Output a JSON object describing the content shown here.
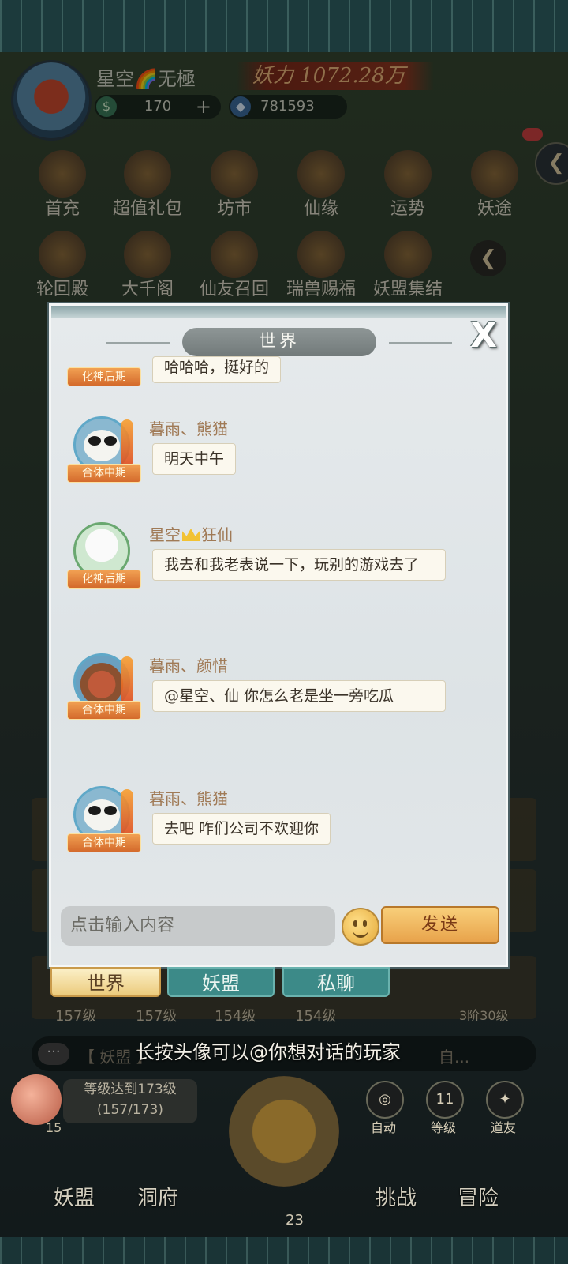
{
  "header": {
    "player_name": "星空🌈无極",
    "power_label": "妖力 1072.28万",
    "currency_jade": "170",
    "currency_gem": "781593",
    "add_label": "+"
  },
  "menu_row1": [
    "首充",
    "超值礼包",
    "坊市",
    "仙缘",
    "运势",
    "妖途"
  ],
  "menu_row2": [
    "轮回殿",
    "大千阁",
    "仙友召回",
    "瑞兽赐福",
    "妖盟集结"
  ],
  "background": {
    "levels": [
      "157级",
      "157级",
      "154级",
      "154级"
    ],
    "stage": "3阶30级",
    "chat_channel": "【 妖盟 】",
    "chat_trail": "自...",
    "goal_line1": "等级达到173级",
    "goal_line2": "(157/173)",
    "peach_count": "15",
    "auto_label": "自动",
    "level_label": "等级",
    "level_value": "11",
    "dress_label": "道友",
    "nav": [
      "妖盟",
      "洞府",
      "挑战",
      "冒险"
    ],
    "axe_count": "23"
  },
  "dialog": {
    "title": "世界",
    "close_label": "X",
    "messages": [
      {
        "rank": "化神后期",
        "name": "",
        "text": "哈哈哈，挺好的"
      },
      {
        "rank": "合体中期",
        "name": "暮雨、熊猫",
        "text": "明天中午"
      },
      {
        "rank": "化神后期",
        "name_prefix": "星空",
        "name_suffix": "狂仙",
        "text": "我去和我老表说一下，玩别的游戏去了"
      },
      {
        "rank": "合体中期",
        "name": "暮雨、颜惜",
        "text": "@星空、仙 你怎么老是坐一旁吃瓜"
      },
      {
        "rank": "合体中期",
        "name": "暮雨、熊猫",
        "text": "去吧 咋们公司不欢迎你"
      }
    ],
    "input_placeholder": "点击输入内容",
    "send_label": "发送"
  },
  "tabs": {
    "world": "世界",
    "guild": "妖盟",
    "private": "私聊"
  },
  "tip": "长按头像可以@你想对话的玩家",
  "colors": {
    "accent_orange": "#e8a24a",
    "rank_badge": "#d46a2c",
    "tab_teal": "#3c8a88",
    "name_brown": "#a07a56"
  }
}
